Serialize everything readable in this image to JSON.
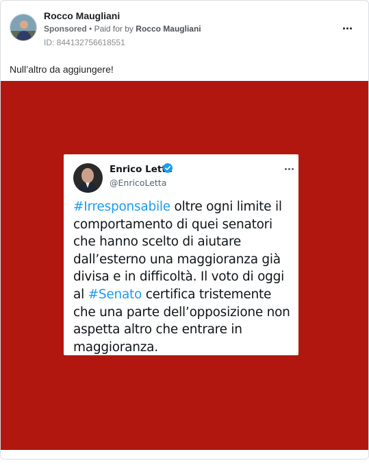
{
  "post": {
    "page_name": "Rocco Maugliani",
    "sponsored_label": "Sponsored",
    "paid_for_prefix": "Paid for by",
    "payer_name": "Rocco Maugliani",
    "ad_id": "ID: 844132756618551",
    "body_text": "Null’altro da aggiungere!",
    "more_options_icon": "ellipsis-icon",
    "creative_background": "#b1170f"
  },
  "tweet": {
    "author_name": "Enrico Letta",
    "handle": "@EnricoLetta",
    "verified_icon": "verified-badge-icon",
    "hashtag_color": "#1d9bf0",
    "lines": [
      {
        "hashtag": "#Irresponsabile",
        "text": " oltre ogni limite il"
      },
      {
        "hashtag": "",
        "text": "comportamento di quei senatori"
      },
      {
        "hashtag": "",
        "text": "che hanno scelto di aiutare"
      },
      {
        "hashtag": "",
        "text": "dall’esterno una maggioranza già"
      },
      {
        "hashtag": "",
        "text": "divisa e in difficoltà. Il voto di oggi"
      },
      {
        "hashtag": "#Senato",
        "prefix": "al ",
        "text": " certifica tristemente"
      },
      {
        "hashtag": "",
        "text": "che una parte dell’opposizione non"
      },
      {
        "hashtag": "",
        "text": "aspetta altro che entrare in"
      },
      {
        "hashtag": "",
        "text": "maggioranza."
      }
    ]
  }
}
